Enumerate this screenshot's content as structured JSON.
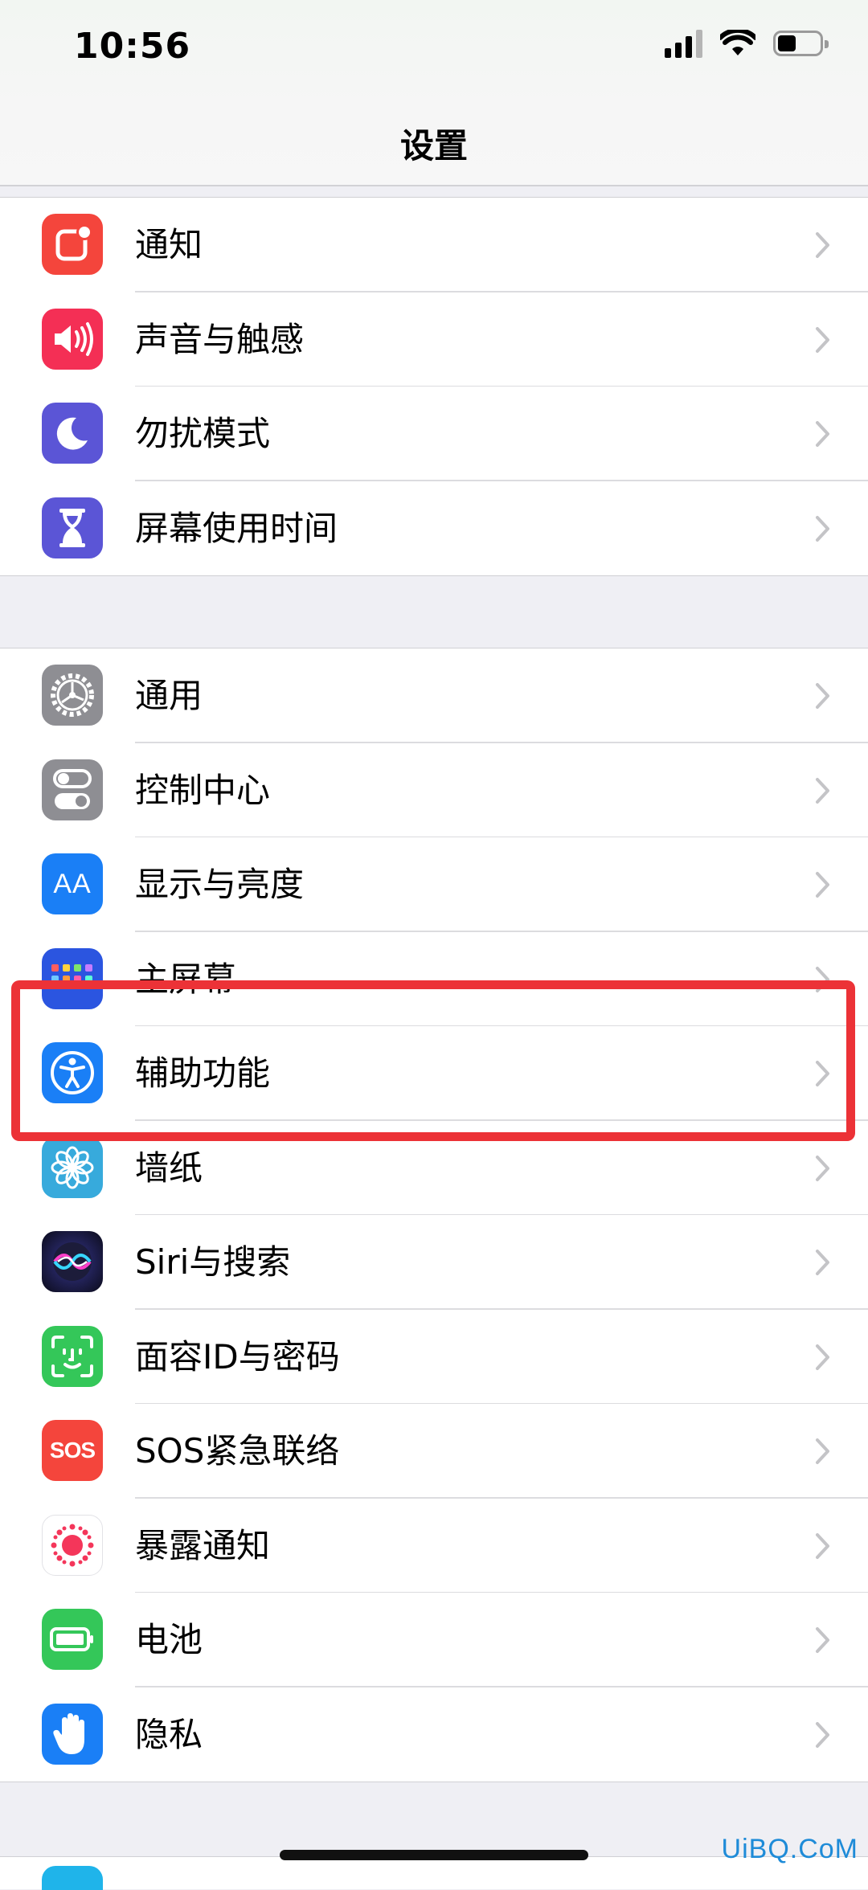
{
  "status_bar": {
    "time": "10:56",
    "signal_bars": 4,
    "signal_active_bars": 3,
    "wifi": "wifi-icon",
    "battery_level": 0.4
  },
  "nav": {
    "title": "设置"
  },
  "groups": [
    {
      "items": [
        {
          "label": "通知",
          "icon": "notifications-icon",
          "color": "#f4453c"
        },
        {
          "label": "声音与触感",
          "icon": "sound-icon",
          "color": "#f42f55"
        },
        {
          "label": "勿扰模式",
          "icon": "moon-icon",
          "color": "#5b55d6"
        },
        {
          "label": "屏幕使用时间",
          "icon": "hourglass-icon",
          "color": "#5b55d6"
        }
      ]
    },
    {
      "items": [
        {
          "label": "通用",
          "icon": "gear-icon",
          "color": "#8e8e93"
        },
        {
          "label": "控制中心",
          "icon": "toggles-icon",
          "color": "#8e8e93"
        },
        {
          "label": "显示与亮度",
          "icon": "text-size-icon",
          "color": "#1a7ff6"
        },
        {
          "label": "主屏幕",
          "icon": "home-screen-icon",
          "color": "#2b55e0"
        },
        {
          "label": "辅助功能",
          "icon": "accessibility-icon",
          "color": "#1a7ff6"
        },
        {
          "label": "墙纸",
          "icon": "flower-icon",
          "color": "#37aadc"
        },
        {
          "label": "Siri与搜索",
          "icon": "siri-icon",
          "color": "#1a1a2e"
        },
        {
          "label": "面容ID与密码",
          "icon": "face-id-icon",
          "color": "#34c759"
        },
        {
          "label": "SOS紧急联络",
          "icon": "sos-icon",
          "color": "#f4453c"
        },
        {
          "label": "暴露通知",
          "icon": "exposure-icon",
          "color": "#ffffff"
        },
        {
          "label": "电池",
          "icon": "battery-icon",
          "color": "#34c759"
        },
        {
          "label": "隐私",
          "icon": "hand-icon",
          "color": "#1a7ff6"
        }
      ]
    }
  ],
  "icon_text": {
    "display": "AA",
    "sos": "SOS"
  },
  "highlight_color": "#ec3237",
  "watermark": "UiBQ.CoM"
}
